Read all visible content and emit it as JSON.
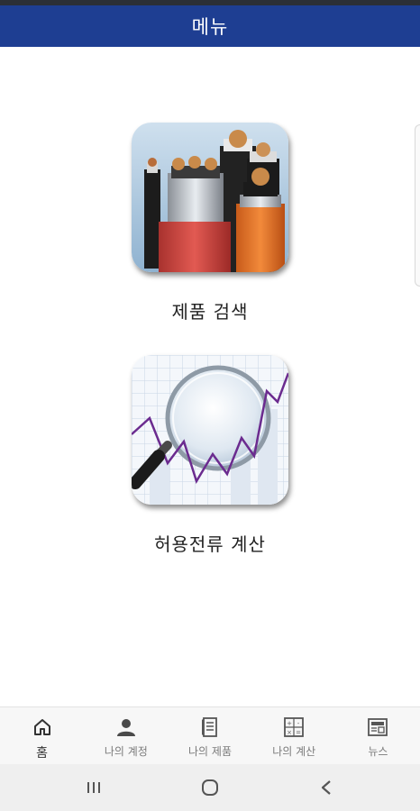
{
  "header": {
    "title": "메뉴"
  },
  "menu": {
    "items": [
      {
        "label": "제품 검색",
        "icon": "cable-products-icon"
      },
      {
        "label": "허용전류 계산",
        "icon": "magnifier-chart-icon"
      }
    ]
  },
  "bottom_nav": {
    "items": [
      {
        "label": "홈",
        "icon": "home-icon",
        "active": true
      },
      {
        "label": "나의 계정",
        "icon": "person-icon"
      },
      {
        "label": "나의 제품",
        "icon": "document-icon"
      },
      {
        "label": "나의 계산",
        "icon": "calculator-icon"
      },
      {
        "label": "뉴스",
        "icon": "newspaper-icon"
      }
    ]
  },
  "system_nav": {
    "icons": [
      "recents-icon",
      "home-circle-icon",
      "back-icon"
    ]
  },
  "colors": {
    "header_bg": "#1e3e92",
    "header_text": "#ffffff",
    "nav_bg": "#f7f7f7",
    "chart_line": "#6b2b8f"
  }
}
